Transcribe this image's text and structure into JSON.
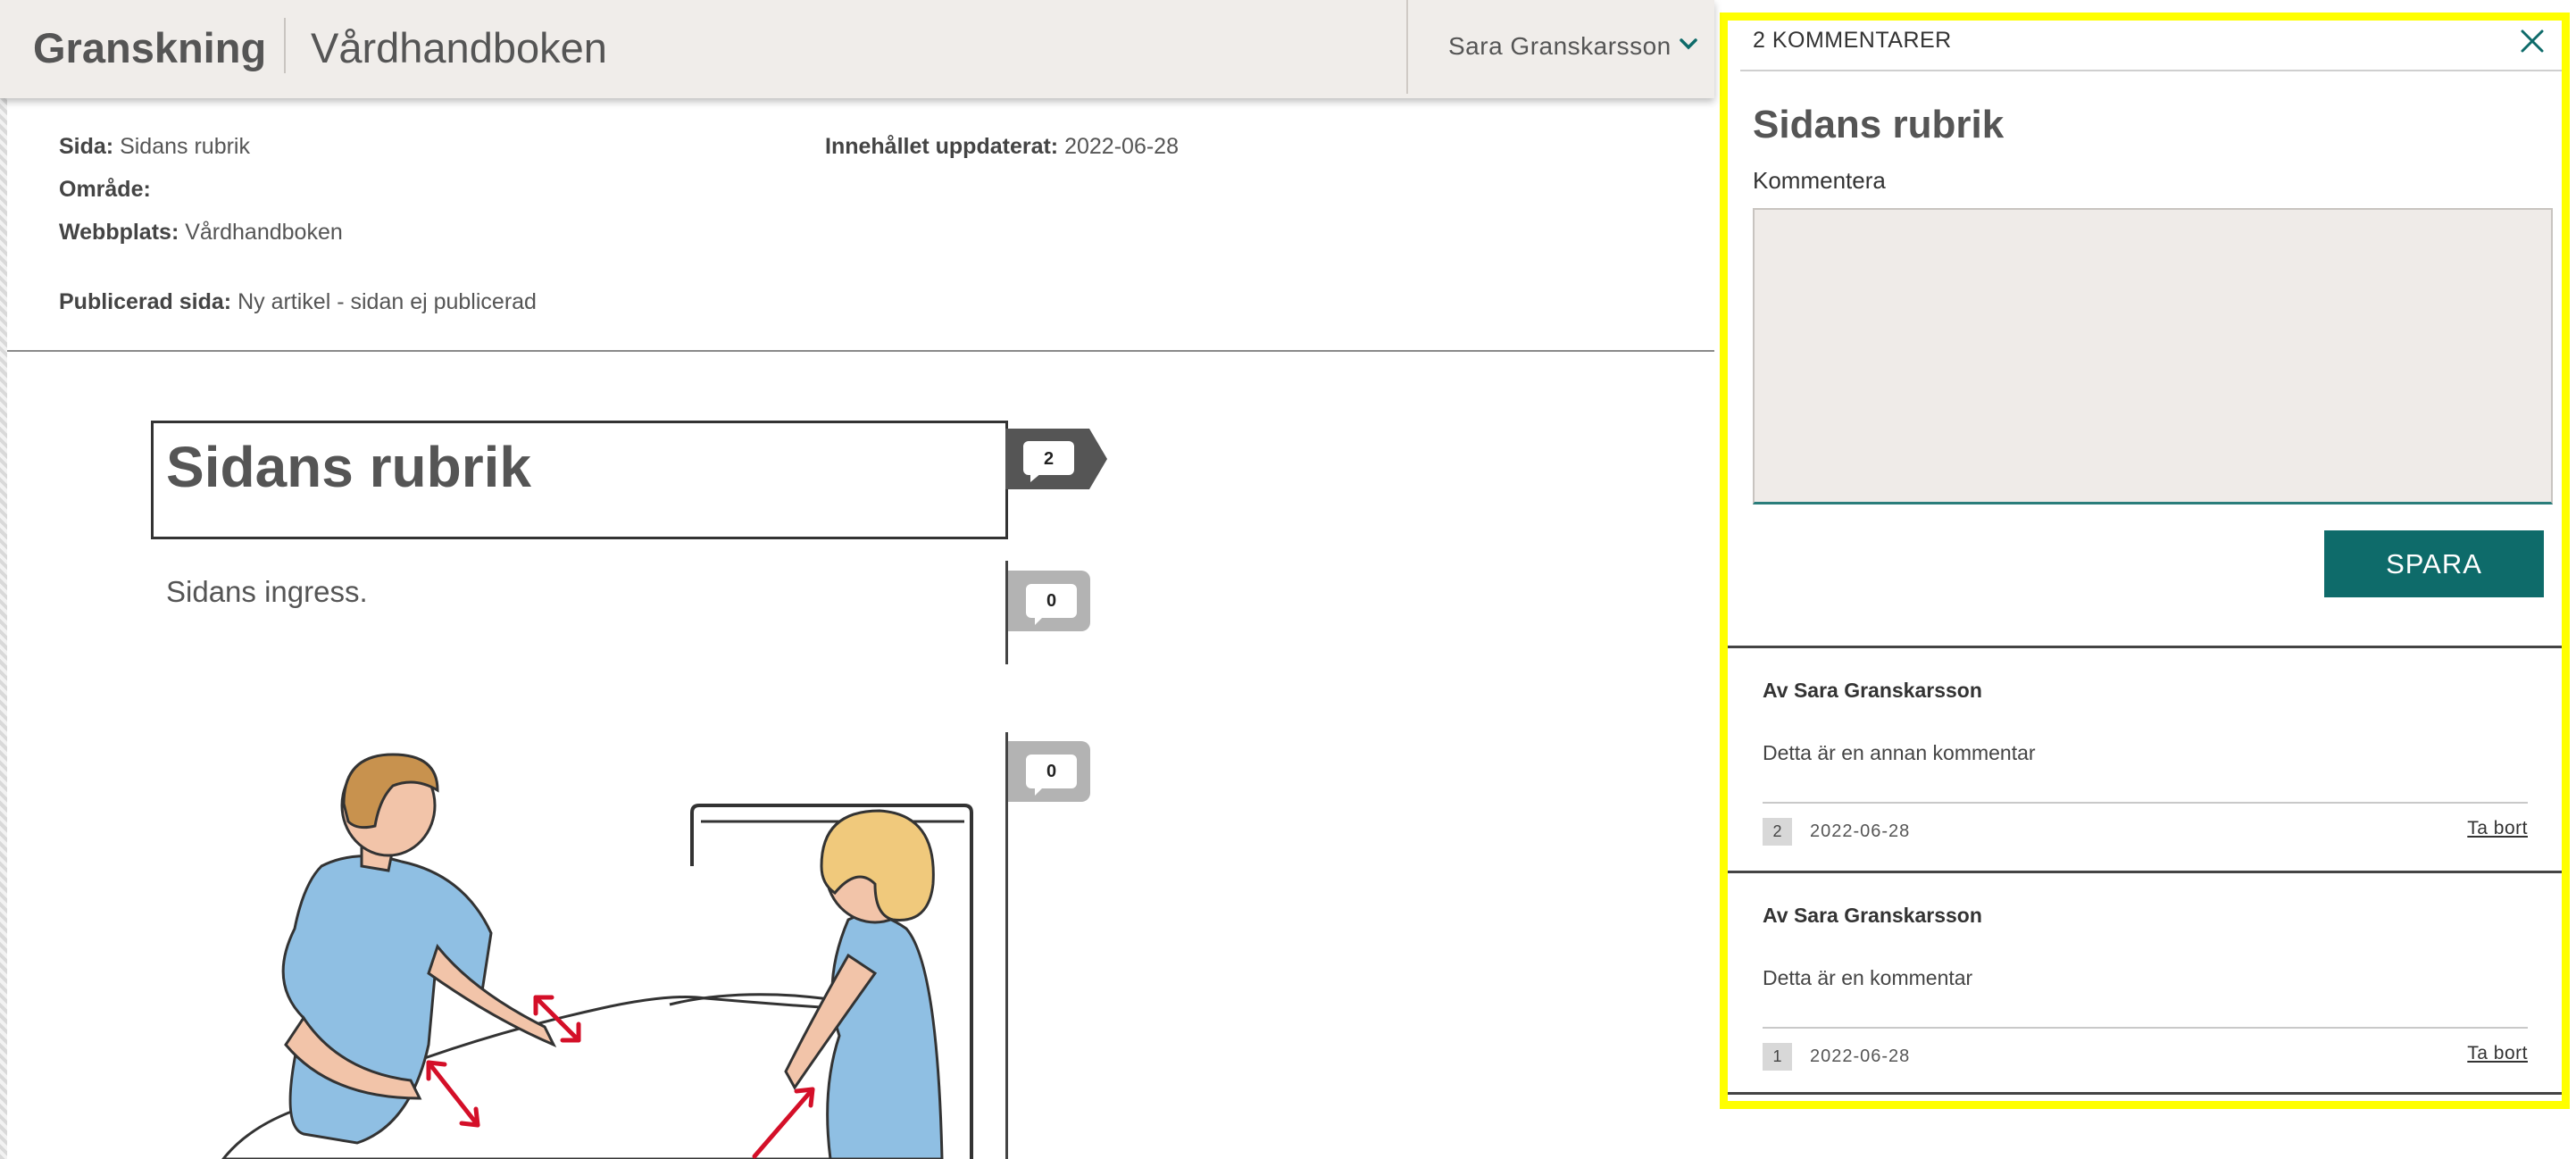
{
  "header": {
    "app_title": "Granskning",
    "site_name": "Vårdhandboken",
    "user_name": "Sara Granskarsson",
    "user_menu_icon": "chevron-down-icon"
  },
  "meta": {
    "page_label": "Sida:",
    "page_value": "Sidans rubrik",
    "area_label": "Område:",
    "area_value": "",
    "website_label": "Webbplats:",
    "website_value": "Vårdhandboken",
    "published_label": "Publicerad sida:",
    "published_value": "Ny artikel - sidan ej publicerad",
    "updated_label": "Innehållet uppdaterat:",
    "updated_value": "2022-06-28"
  },
  "content": {
    "heading": "Sidans rubrik",
    "ingress": "Sidans ingress.",
    "blocks": [
      {
        "comment_count": "2",
        "active": true
      },
      {
        "comment_count": "0",
        "active": false
      },
      {
        "comment_count": "0",
        "active": false
      }
    ],
    "illustration": "two-nurses-making-bed-illustration"
  },
  "panel": {
    "count_label": "2 KOMMENTARER",
    "close_icon": "close-icon",
    "title": "Sidans rubrik",
    "comment_label": "Kommentera",
    "comment_value": "",
    "save_label": "SPARA",
    "comments": [
      {
        "author": "Av Sara Granskarsson",
        "text": "Detta är en annan kommentar",
        "number": "2",
        "date": "2022-06-28",
        "remove_label": "Ta bort"
      },
      {
        "author": "Av Sara Granskarsson",
        "text": "Detta är en kommentar",
        "number": "1",
        "date": "2022-06-28",
        "remove_label": "Ta bort"
      }
    ]
  },
  "colors": {
    "header_bg": "#f0edea",
    "accent_teal": "#0e6b6a",
    "highlight_yellow": "#ffff00",
    "badge_active": "#555555",
    "badge_inactive": "#b3b3b3"
  }
}
